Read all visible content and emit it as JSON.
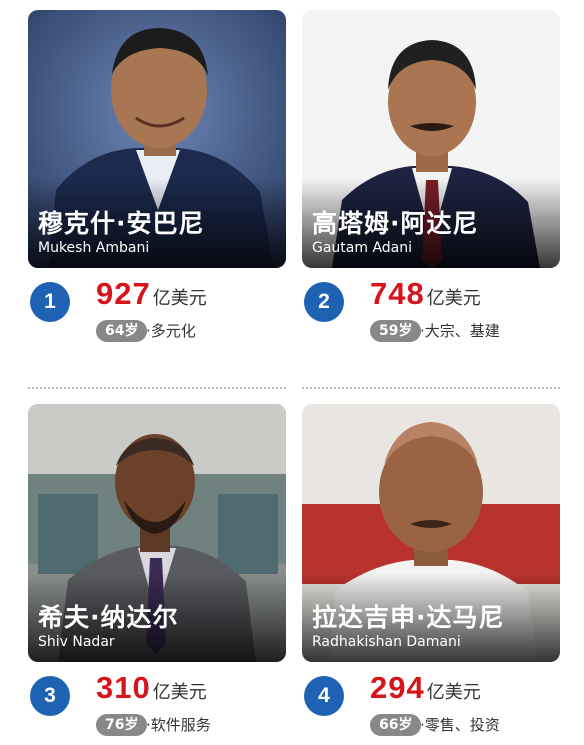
{
  "cards": [
    {
      "rank": "1",
      "name_zh": "穆克什·安巴尼",
      "name_en": "Mukesh Ambani",
      "worth": "927",
      "unit": "亿美元",
      "age": "64岁",
      "industry": "·多元化"
    },
    {
      "rank": "2",
      "name_zh": "高塔姆·阿达尼",
      "name_en": "Gautam Adani",
      "worth": "748",
      "unit": "亿美元",
      "age": "59岁",
      "industry": "·大宗、基建"
    },
    {
      "rank": "3",
      "name_zh": "希夫·纳达尔",
      "name_en": "Shiv Nadar",
      "worth": "310",
      "unit": "亿美元",
      "age": "76岁",
      "industry": "·软件服务"
    },
    {
      "rank": "4",
      "name_zh": "拉达吉申·达马尼",
      "name_en": "Radhakishan Damani",
      "worth": "294",
      "unit": "亿美元",
      "age": "66岁",
      "industry": "·零售、投资"
    }
  ],
  "colors": {
    "rank_badge": "#1f62b3",
    "worth_number": "#d6141c",
    "age_pill": "#888888"
  }
}
